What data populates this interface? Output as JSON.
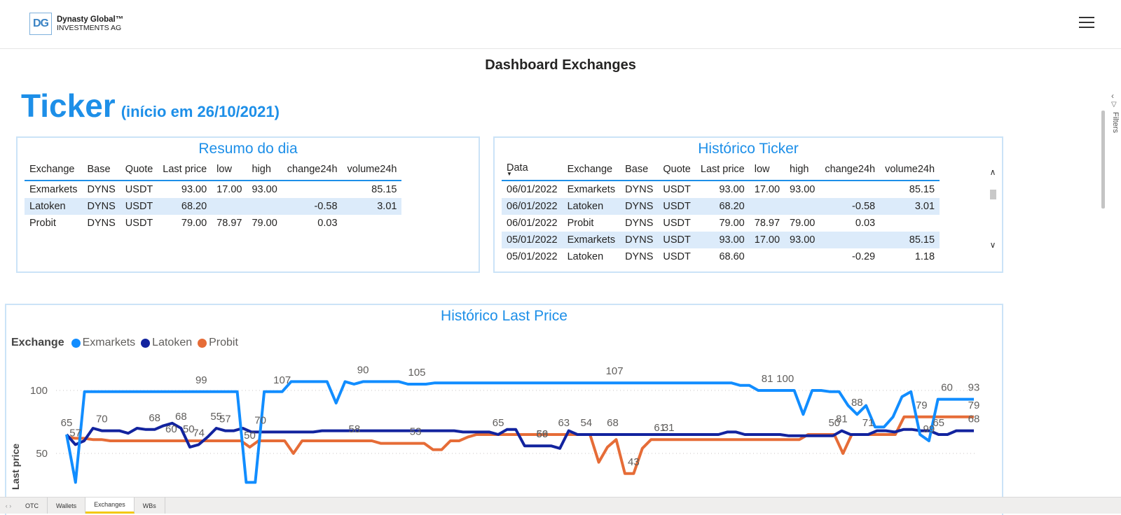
{
  "header": {
    "logo_mark": "DG",
    "logo_line1": "Dynasty Global™",
    "logo_line2": "INVESTMENTS AG",
    "menu_icon": "hamburger-icon"
  },
  "page_title": "Dashboard Exchanges",
  "ticker": {
    "title": "Ticker",
    "subtitle": "(início em 26/10/2021)"
  },
  "resumo": {
    "title": "Resumo do dia",
    "columns": [
      "Exchange",
      "Base",
      "Quote",
      "Last price",
      "low",
      "high",
      "change24h",
      "volume24h"
    ],
    "rows": [
      [
        "Exmarkets",
        "DYNS",
        "USDT",
        "93.00",
        "17.00",
        "93.00",
        "",
        "85.15"
      ],
      [
        "Latoken",
        "DYNS",
        "USDT",
        "68.20",
        "",
        "",
        "-0.58",
        "3.01"
      ],
      [
        "Probit",
        "DYNS",
        "USDT",
        "79.00",
        "78.97",
        "79.00",
        "0.03",
        ""
      ]
    ]
  },
  "historico": {
    "title": "Histórico Ticker",
    "columns": [
      "Data",
      "Exchange",
      "Base",
      "Quote",
      "Last price",
      "low",
      "high",
      "change24h",
      "volume24h"
    ],
    "rows": [
      [
        "06/01/2022",
        "Exmarkets",
        "DYNS",
        "USDT",
        "93.00",
        "17.00",
        "93.00",
        "",
        "85.15"
      ],
      [
        "06/01/2022",
        "Latoken",
        "DYNS",
        "USDT",
        "68.20",
        "",
        "",
        "-0.58",
        "3.01"
      ],
      [
        "06/01/2022",
        "Probit",
        "DYNS",
        "USDT",
        "79.00",
        "78.97",
        "79.00",
        "0.03",
        ""
      ],
      [
        "05/01/2022",
        "Exmarkets",
        "DYNS",
        "USDT",
        "93.00",
        "17.00",
        "93.00",
        "",
        "85.15"
      ],
      [
        "05/01/2022",
        "Latoken",
        "DYNS",
        "USDT",
        "68.60",
        "",
        "",
        "-0.29",
        "1.18"
      ]
    ]
  },
  "chart_data": {
    "type": "line",
    "title": "Histórico Last Price",
    "legend_title": "Exchange",
    "ylabel": "Last price",
    "yticks": [
      50,
      100
    ],
    "ylim": [
      25,
      110
    ],
    "legend_position": "top-left",
    "series": [
      {
        "name": "Exmarkets",
        "color": "#118dff",
        "values": [
          65,
          27,
          99,
          99,
          99,
          99,
          99,
          99,
          99,
          99,
          99,
          99,
          99,
          99,
          99,
          99,
          99,
          99,
          99,
          99,
          27,
          27,
          99,
          99,
          99,
          107,
          107,
          107,
          107,
          107,
          90,
          107,
          105,
          107,
          107,
          107,
          107,
          107,
          105,
          105,
          105,
          106,
          106,
          106,
          106,
          106,
          106,
          106,
          106,
          106,
          106,
          106,
          106,
          106,
          106,
          106,
          106,
          106,
          106,
          106,
          106,
          106,
          106,
          106,
          106,
          106,
          106,
          106,
          106,
          106,
          106,
          106,
          106,
          106,
          106,
          104,
          104,
          100,
          100,
          100,
          100,
          100,
          81,
          100,
          100,
          99,
          99,
          88,
          81,
          88,
          71,
          71,
          79,
          95,
          99,
          65,
          60,
          93,
          93,
          93,
          93,
          93
        ]
      },
      {
        "name": "Latoken",
        "color": "#12239e",
        "values": [
          65,
          57,
          60,
          70,
          68,
          68,
          68,
          66,
          70,
          69,
          69,
          72,
          74,
          70,
          55,
          57,
          63,
          70,
          68,
          68,
          70,
          67,
          67,
          67,
          67,
          67,
          67,
          67,
          67,
          68,
          68,
          68,
          68,
          68,
          68,
          68,
          68,
          68,
          68,
          68,
          68,
          68,
          68,
          68,
          68,
          67,
          67,
          67,
          67,
          65,
          69,
          69,
          56,
          56,
          56,
          56,
          54,
          68,
          65,
          65,
          65,
          65,
          65,
          65,
          65,
          65,
          65,
          65,
          65,
          65,
          65,
          65,
          65,
          65,
          65,
          67,
          67,
          65,
          65,
          65,
          65,
          65,
          64,
          64,
          64,
          64,
          64,
          64,
          68,
          65,
          65,
          65,
          68,
          68,
          67,
          69,
          69,
          68,
          68,
          65,
          65,
          68,
          68,
          68
        ]
      },
      {
        "name": "Probit",
        "color": "#e66c37",
        "values": [
          63,
          62,
          62,
          61,
          61,
          60,
          60,
          60,
          60,
          60,
          60,
          60,
          60,
          60,
          60,
          60,
          60,
          60,
          60,
          60,
          60,
          55,
          60,
          60,
          60,
          60,
          50,
          60,
          60,
          60,
          60,
          60,
          60,
          60,
          60,
          60,
          58,
          58,
          58,
          58,
          58,
          58,
          53,
          53,
          60,
          60,
          63,
          65,
          65,
          65,
          65,
          65,
          65,
          65,
          65,
          65,
          65,
          65,
          65,
          65,
          65,
          43,
          55,
          61,
          34,
          34,
          54,
          61,
          61,
          61,
          61,
          61,
          61,
          61,
          61,
          61,
          61,
          61,
          61,
          61,
          61,
          61,
          61,
          61,
          61,
          65,
          65,
          65,
          65,
          50,
          65,
          65,
          65,
          65,
          65,
          65,
          79,
          79,
          79,
          79,
          79,
          79,
          79,
          79,
          79
        ]
      }
    ],
    "data_labels": [
      {
        "text": "65",
        "series": "Exmarkets",
        "index": 0
      },
      {
        "text": "57",
        "series": "Latoken",
        "index": 1
      },
      {
        "text": "70",
        "series": "Latoken",
        "index": 3
      },
      {
        "text": "68",
        "series": "Latoken",
        "index": 8
      },
      {
        "text": "68",
        "series": "Latoken",
        "index": 10
      },
      {
        "text": "60",
        "series": "Probit",
        "index": 9
      },
      {
        "text": "74",
        "series": "Latoken",
        "index": 12
      },
      {
        "text": "55",
        "series": "Latoken",
        "index": 13
      },
      {
        "text": "99",
        "series": "Exmarkets",
        "index": 12
      },
      {
        "text": "50",
        "series": "Probit",
        "index": 11
      },
      {
        "text": "57",
        "series": "Latoken",
        "index": 14
      },
      {
        "text": "70",
        "series": "Latoken",
        "index": 17
      },
      {
        "text": "50",
        "series": "Probit",
        "index": 16
      },
      {
        "text": "107",
        "series": "Exmarkets",
        "index": 19
      },
      {
        "text": "90",
        "series": "Exmarkets",
        "index": 26
      },
      {
        "text": "58",
        "series": "Probit",
        "index": 25
      },
      {
        "text": "105",
        "series": "Exmarkets",
        "index": 31
      },
      {
        "text": "53",
        "series": "Probit",
        "index": 31
      },
      {
        "text": "65",
        "series": "Latoken",
        "index": 38
      },
      {
        "text": "69",
        "series": "Latoken",
        "index": 42
      },
      {
        "text": "56",
        "series": "Latoken",
        "index": 42
      },
      {
        "text": "63",
        "series": "Probit",
        "index": 44
      },
      {
        "text": "54",
        "series": "Latoken",
        "index": 46
      },
      {
        "text": "107",
        "series": "Exmarkets",
        "index": 48
      },
      {
        "text": "68",
        "series": "Latoken",
        "index": 48
      },
      {
        "text": "43",
        "series": "Probit",
        "index": 50
      },
      {
        "text": "61",
        "series": "Probit",
        "index": 52
      },
      {
        "text": "31",
        "series": "Probit",
        "index": 53
      },
      {
        "text": "100",
        "series": "Exmarkets",
        "index": 63
      },
      {
        "text": "81",
        "series": "Exmarkets",
        "index": 62
      },
      {
        "text": "81",
        "series": "Latoken",
        "index": 68
      },
      {
        "text": "50",
        "series": "Probit",
        "index": 68
      },
      {
        "text": "88",
        "series": "Exmarkets",
        "index": 70
      },
      {
        "text": "71",
        "series": "Latoken",
        "index": 71
      },
      {
        "text": "79",
        "series": "Probit",
        "index": 75
      },
      {
        "text": "99",
        "series": "Exmarkets",
        "index": 76
      },
      {
        "text": "65",
        "series": "Latoken",
        "index": 77
      },
      {
        "text": "60",
        "series": "Exmarkets",
        "index": 78
      },
      {
        "text": "93",
        "series": "Exmarkets",
        "index": 80
      },
      {
        "text": "79",
        "series": "Probit",
        "index": 80
      },
      {
        "text": "68",
        "series": "Latoken",
        "index": 80
      }
    ]
  },
  "rail": {
    "collapse_icon": "chevron-left-icon",
    "filter_icon": "filter-icon",
    "filters_label": "Filters"
  },
  "tabs": {
    "items": [
      "OTC",
      "Wallets",
      "Exchanges",
      "WBs"
    ],
    "active": "Exchanges"
  }
}
